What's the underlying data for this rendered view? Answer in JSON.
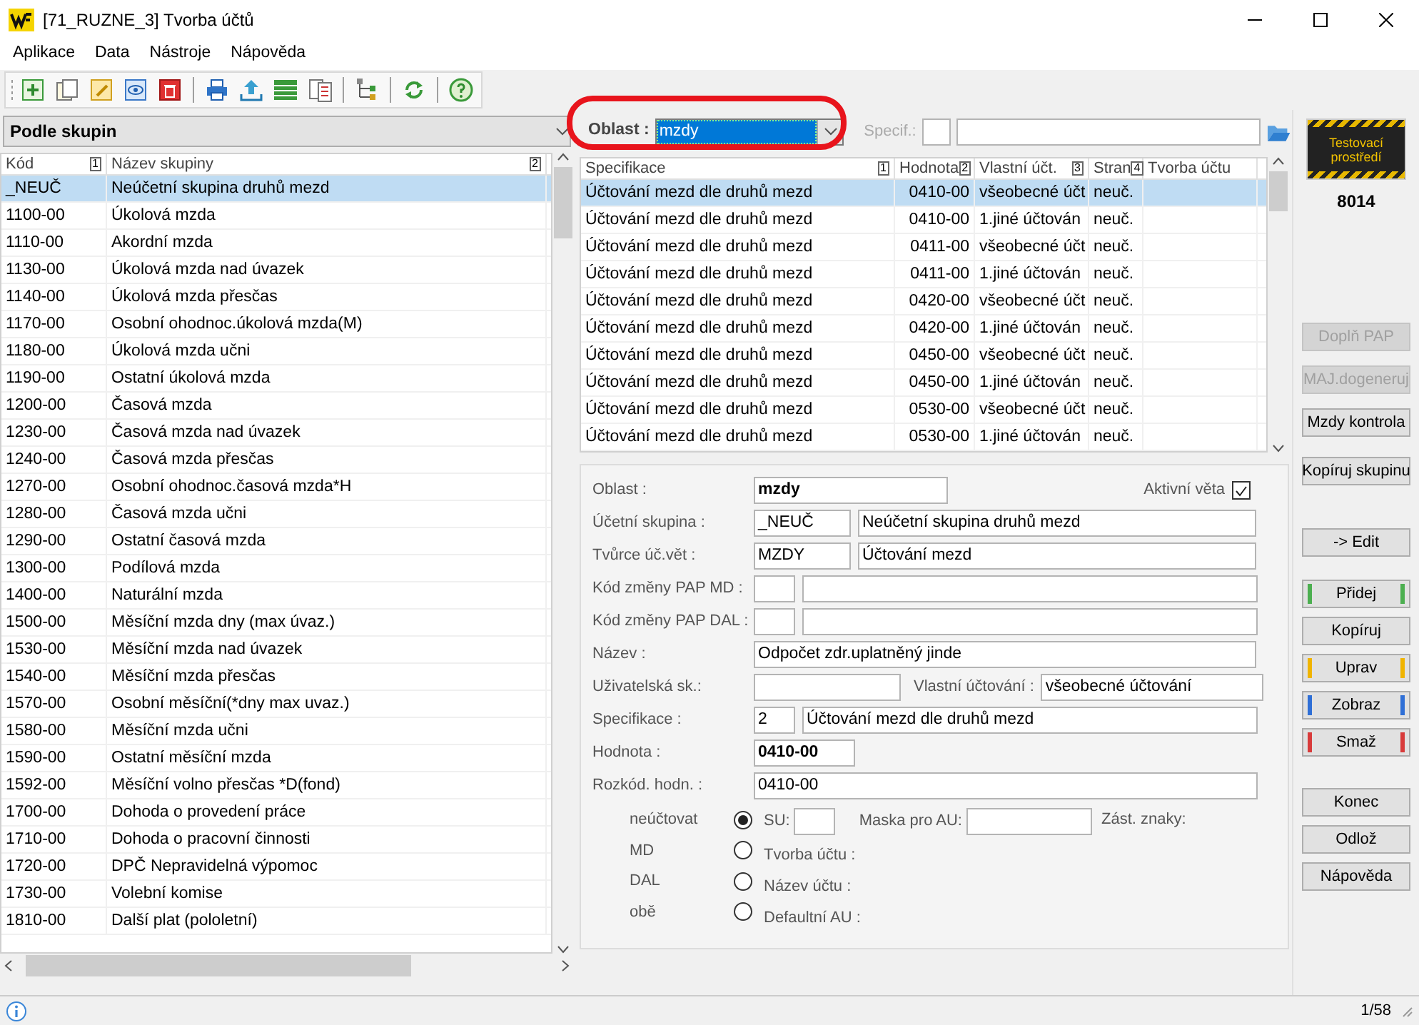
{
  "window": {
    "title": "[71_RUZNE_3] Tvorba účtů"
  },
  "menu": [
    "Aplikace",
    "Data",
    "Nástroje",
    "Nápověda"
  ],
  "toolbar": [
    {
      "kind": "add"
    },
    {
      "kind": "copy"
    },
    {
      "kind": "edit"
    },
    {
      "kind": "view"
    },
    {
      "kind": "delete"
    },
    {
      "kind": "sep"
    },
    {
      "kind": "print"
    },
    {
      "kind": "export"
    },
    {
      "kind": "table"
    },
    {
      "kind": "document"
    },
    {
      "kind": "sep"
    },
    {
      "kind": "tree"
    },
    {
      "kind": "sep"
    },
    {
      "kind": "refresh"
    },
    {
      "kind": "sep"
    },
    {
      "kind": "help"
    }
  ],
  "group_select": {
    "value": "Podle skupin"
  },
  "groups": {
    "columns": [
      {
        "label": "Kód",
        "sort": "1"
      },
      {
        "label": "Název skupiny",
        "sort": "2"
      }
    ],
    "rows": [
      {
        "code": "_NEUČ",
        "name": "Neúčetní skupina druhů mezd",
        "selected": true
      },
      {
        "code": "1100-00",
        "name": "Úkolová mzda",
        "selected": false
      },
      {
        "code": "1110-00",
        "name": "Akordní mzda",
        "selected": false
      },
      {
        "code": "1130-00",
        "name": "Úkolová mzda nad úvazek",
        "selected": false
      },
      {
        "code": "1140-00",
        "name": "Úkolová mzda přesčas",
        "selected": false
      },
      {
        "code": "1170-00",
        "name": "Osobní ohodnoc.úkolová mzda(M)",
        "selected": false
      },
      {
        "code": "1180-00",
        "name": "Úkolová mzda učni",
        "selected": false
      },
      {
        "code": "1190-00",
        "name": "Ostatní úkolová mzda",
        "selected": false
      },
      {
        "code": "1200-00",
        "name": "Časová mzda",
        "selected": false
      },
      {
        "code": "1230-00",
        "name": "Časová mzda nad úvazek",
        "selected": false
      },
      {
        "code": "1240-00",
        "name": "Časová mzda přesčas",
        "selected": false
      },
      {
        "code": "1270-00",
        "name": "Osobní ohodnoc.časová mzda*H",
        "selected": false
      },
      {
        "code": "1280-00",
        "name": "Časová mzda učni",
        "selected": false
      },
      {
        "code": "1290-00",
        "name": "Ostatní časová mzda",
        "selected": false
      },
      {
        "code": "1300-00",
        "name": "Podílová mzda",
        "selected": false
      },
      {
        "code": "1400-00",
        "name": "Naturální mzda",
        "selected": false
      },
      {
        "code": "1500-00",
        "name": "Měsíční mzda dny (max úvaz.)",
        "selected": false
      },
      {
        "code": "1530-00",
        "name": "Měsíční mzda nad úvazek",
        "selected": false
      },
      {
        "code": "1540-00",
        "name": "Měsíční mzda přesčas",
        "selected": false
      },
      {
        "code": "1570-00",
        "name": "Osobní měsíční(*dny max uvaz.)",
        "selected": false
      },
      {
        "code": "1580-00",
        "name": "Měsíční mzda učni",
        "selected": false
      },
      {
        "code": "1590-00",
        "name": "Ostatní měsíční mzda",
        "selected": false
      },
      {
        "code": "1592-00",
        "name": "Měsíční volno přesčas *D(fond)",
        "selected": false
      },
      {
        "code": "1700-00",
        "name": "Dohoda o provedení práce",
        "selected": false
      },
      {
        "code": "1710-00",
        "name": "Dohoda o pracovní činnosti",
        "selected": false
      },
      {
        "code": "1720-00",
        "name": "DPČ Nepravidelná výpomoc",
        "selected": false
      },
      {
        "code": "1730-00",
        "name": "Volební komise",
        "selected": false
      },
      {
        "code": "1810-00",
        "name": "Další plat (pololetní)",
        "selected": false
      }
    ]
  },
  "filter": {
    "oblast_label": "Oblast :",
    "oblast_value": "mzdy",
    "specif_label": "Specif.:"
  },
  "specs": {
    "columns": [
      {
        "label": "Specifikace",
        "sort": "1"
      },
      {
        "label": "Hodnota",
        "sort": "2"
      },
      {
        "label": "Vlastní účt.",
        "sort": "3"
      },
      {
        "label": "Stran",
        "sort": "4"
      },
      {
        "label": "Tvorba účtu"
      }
    ],
    "rows": [
      {
        "spec": "Účtování mezd dle druhů mezd",
        "value": "0410-00",
        "own": "všeobecné účt",
        "side": "neuč.",
        "selected": true
      },
      {
        "spec": "Účtování mezd dle druhů mezd",
        "value": "0410-00",
        "own": "1.jiné účtován",
        "side": "neuč.",
        "selected": false
      },
      {
        "spec": "Účtování mezd dle druhů mezd",
        "value": "0411-00",
        "own": "všeobecné účt",
        "side": "neuč.",
        "selected": false
      },
      {
        "spec": "Účtování mezd dle druhů mezd",
        "value": "0411-00",
        "own": "1.jiné účtován",
        "side": "neuč.",
        "selected": false
      },
      {
        "spec": "Účtování mezd dle druhů mezd",
        "value": "0420-00",
        "own": "všeobecné účt",
        "side": "neuč.",
        "selected": false
      },
      {
        "spec": "Účtování mezd dle druhů mezd",
        "value": "0420-00",
        "own": "1.jiné účtován",
        "side": "neuč.",
        "selected": false
      },
      {
        "spec": "Účtování mezd dle druhů mezd",
        "value": "0450-00",
        "own": "všeobecné účt",
        "side": "neuč.",
        "selected": false
      },
      {
        "spec": "Účtování mezd dle druhů mezd",
        "value": "0450-00",
        "own": "1.jiné účtován",
        "side": "neuč.",
        "selected": false
      },
      {
        "spec": "Účtování mezd dle druhů mezd",
        "value": "0530-00",
        "own": "všeobecné účt",
        "side": "neuč.",
        "selected": false
      },
      {
        "spec": "Účtování mezd dle druhů mezd",
        "value": "0530-00",
        "own": "1.jiné účtován",
        "side": "neuč.",
        "selected": false
      }
    ]
  },
  "form": {
    "active_label": "Aktivní věta",
    "active": true,
    "rows": [
      {
        "kind": "filled",
        "label": "Oblast :",
        "inputs": [
          {
            "value": "mzdy",
            "bold": true
          }
        ]
      },
      {
        "kind": "filled",
        "label": "Účetní skupina :",
        "inputs": [
          {
            "value": "_NEUČ"
          },
          {
            "value": "Neúčetní skupina druhů mezd"
          }
        ]
      },
      {
        "kind": "filled",
        "label": "Tvůrce úč.vět :",
        "inputs": [
          {
            "value": "MZDY"
          },
          {
            "value": "Účtování mezd"
          }
        ]
      },
      {
        "kind": "blank-pair",
        "label": "Kód změny PAP MD :"
      },
      {
        "kind": "blank-pair",
        "label": "Kód změny PAP DAL :"
      },
      {
        "kind": "filled",
        "label": "Název :",
        "inputs": [
          {
            "value": "Odpočet zdr.uplatněný jinde"
          }
        ]
      },
      {
        "kind": "blank-single",
        "label": "Uživatelská sk.:",
        "extra_label": "Vlastní účtování :",
        "extra_value": "všeobecné účtování"
      },
      {
        "kind": "filled",
        "label": "Specifikace :",
        "inputs": [
          {
            "value": "2"
          },
          {
            "value": "Účtování mezd dle druhů mezd"
          }
        ]
      },
      {
        "kind": "filled",
        "label": "Hodnota :",
        "inputs": [
          {
            "value": "0410-00",
            "bold": true
          }
        ]
      },
      {
        "kind": "filled",
        "label": "Rozkód. hodn. :",
        "inputs": [
          {
            "value": "0410-00"
          }
        ]
      }
    ],
    "sides": [
      {
        "label": "neúčtovat",
        "selected": true
      },
      {
        "label": "MD",
        "selected": false
      },
      {
        "label": "DAL",
        "selected": false
      },
      {
        "label": "obě",
        "selected": false
      }
    ],
    "su_label": "SU:",
    "mask_label": "Maska pro AU:",
    "chars_label": "Zást. znaky:",
    "info_labels": [
      "Tvorba účtu :",
      "Název účtu :",
      "Defaultní AU :"
    ]
  },
  "environment": {
    "label": "Testovací prostředí",
    "number": "8014"
  },
  "buttons": [
    {
      "label": "Doplň PAP",
      "disabled": true
    },
    {
      "label": "MAJ.dogeneruj",
      "disabled": true
    },
    {
      "label": "Mzdy kontrola",
      "disabled": false
    },
    {
      "label": "Kopíruj skupinu",
      "disabled": false
    },
    {
      "label": "-> Edit",
      "disabled": false
    },
    {
      "label": "Přidej",
      "disabled": false,
      "color": "#4caf50"
    },
    {
      "label": "Kopíruj",
      "disabled": false
    },
    {
      "label": "Uprav",
      "disabled": false,
      "color": "#f0b400"
    },
    {
      "label": "Zobraz",
      "disabled": false,
      "color": "#2f6fd6"
    },
    {
      "label": "Smaž",
      "disabled": false,
      "color": "#d83b3b"
    },
    {
      "label": "Konec",
      "disabled": false
    },
    {
      "label": "Odlož",
      "disabled": false
    },
    {
      "label": "Nápověda",
      "disabled": false
    }
  ],
  "status_bar": {
    "position": "1/58"
  }
}
